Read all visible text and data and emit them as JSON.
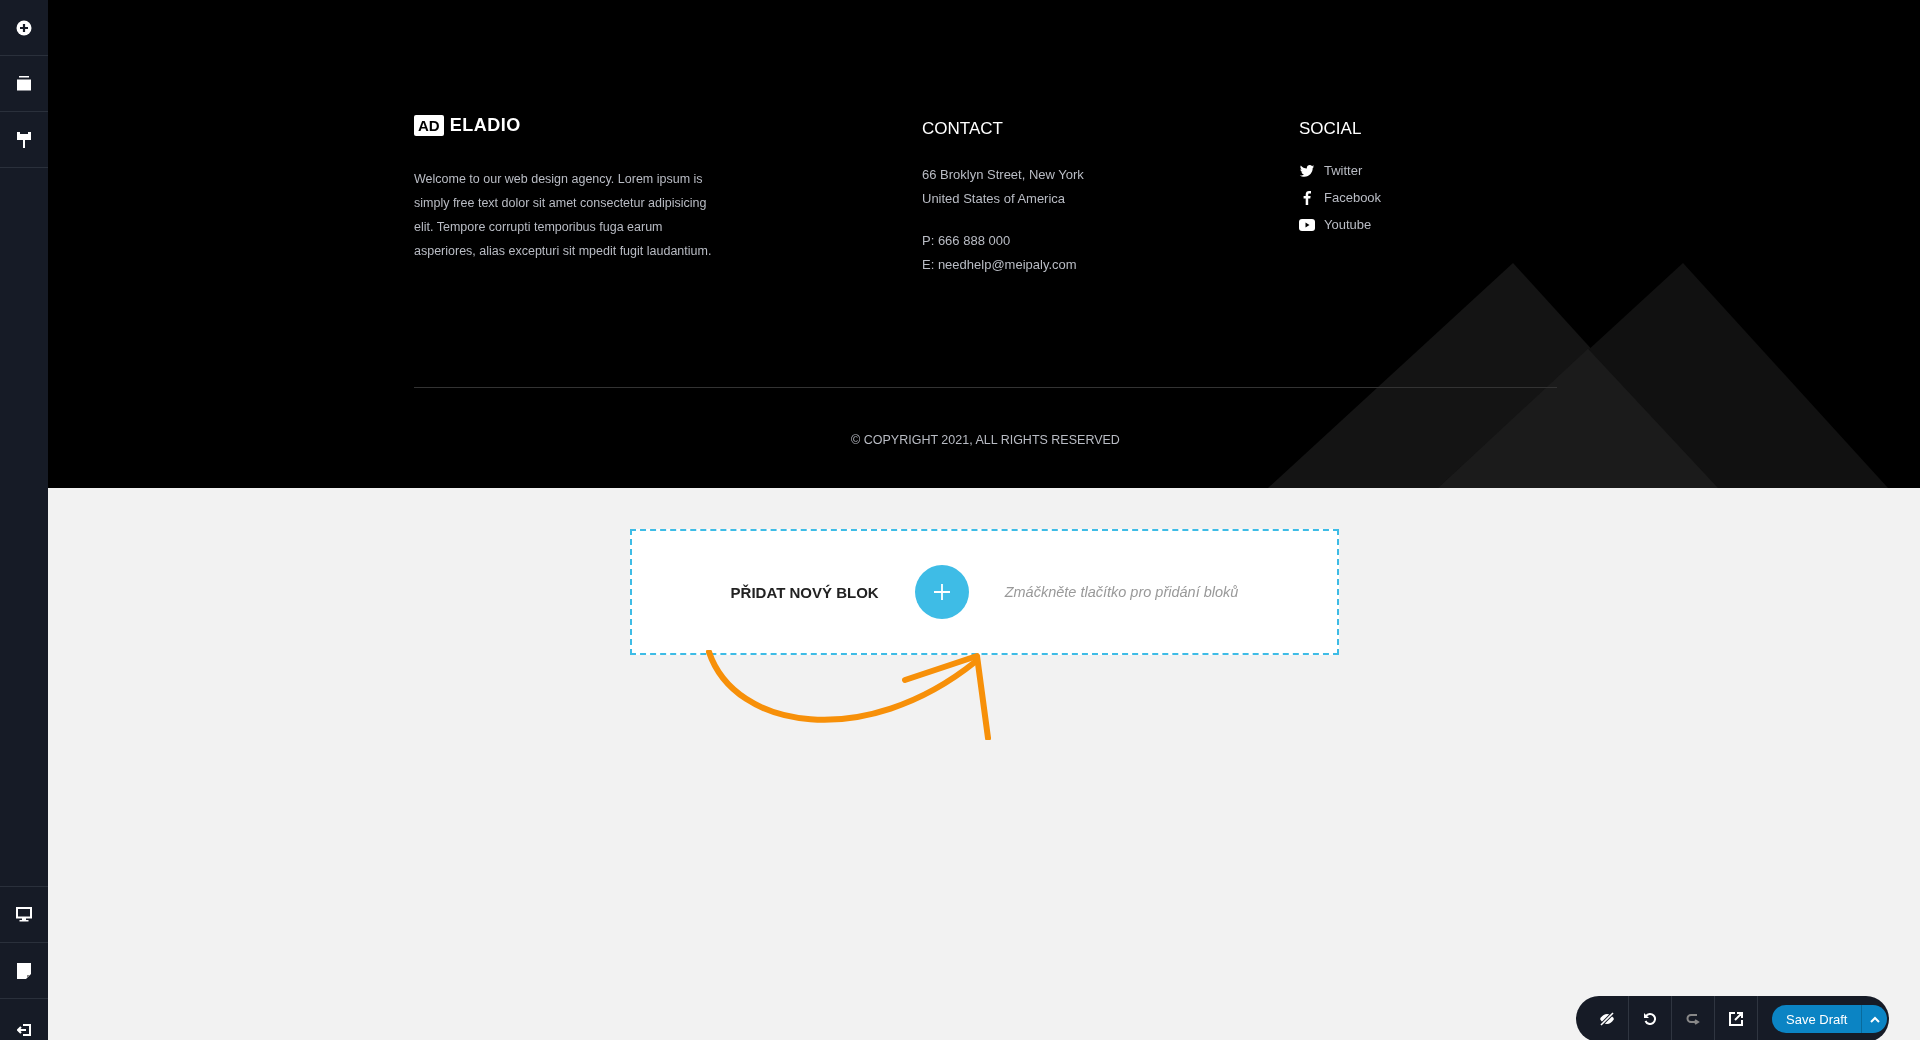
{
  "footer": {
    "logo": {
      "badge": "AD",
      "name": "ELADIO"
    },
    "about": "Welcome to our web design agency. Lorem ipsum is simply free text dolor sit amet consectetur adipisicing elit. Tempore corrupti temporibus fuga earum asperiores, alias excepturi sit mpedit fugit laudantium.",
    "contact": {
      "heading": "CONTACT",
      "address": [
        "66 Broklyn Street, New York",
        "United States of America"
      ],
      "phone": "P: 666 888 000",
      "email": "E: needhelp@meipaly.com"
    },
    "social": {
      "heading": "SOCIAL",
      "links": [
        {
          "kind": "twitter",
          "label": "Twitter"
        },
        {
          "kind": "facebook",
          "label": "Facebook"
        },
        {
          "kind": "youtube",
          "label": "Youtube"
        }
      ]
    },
    "copyright": "© COPYRIGHT 2021, ALL RIGHTS RESERVED"
  },
  "add_block": {
    "title": "PŘIDAT NOVÝ BLOK",
    "hint": "Zmáčkněte tlačítko pro přidání bloků"
  },
  "toolbar": {
    "save_label": "Save Draft"
  }
}
